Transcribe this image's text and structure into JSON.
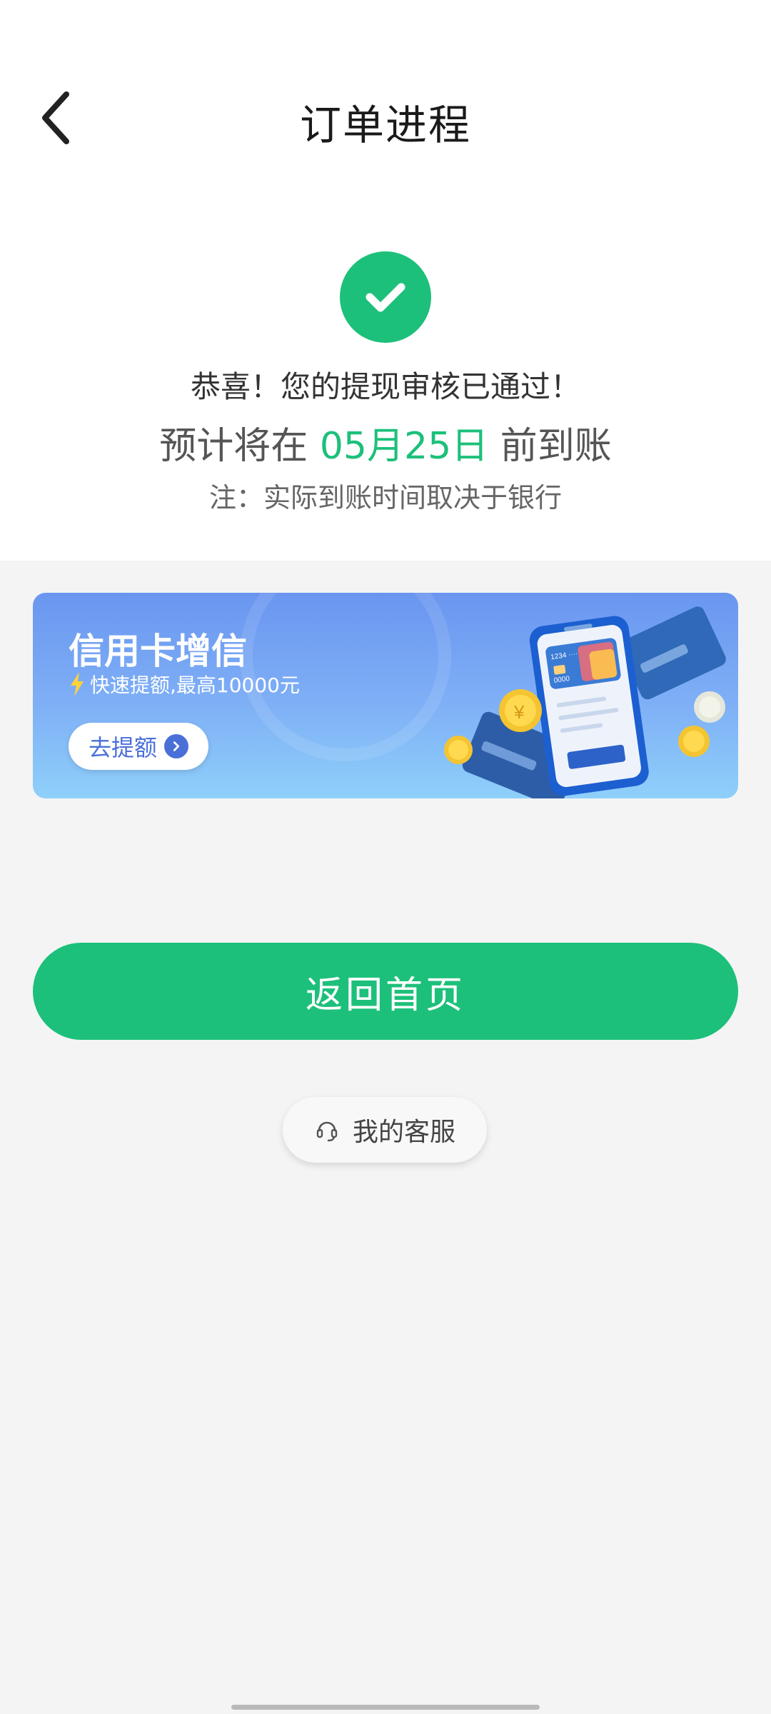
{
  "header": {
    "title": "订单进程"
  },
  "status": {
    "message": "恭喜！您的提现审核已通过！",
    "eta_prefix": "预计将在",
    "eta_date": "05月25日",
    "eta_suffix": "前到账",
    "note": "注：实际到账时间取决于银行"
  },
  "banner": {
    "title": "信用卡增信",
    "subtitle": "快速提额,最高10000元",
    "button_label": "去提额",
    "card_number": "1234 ····",
    "card_number2": "0000"
  },
  "actions": {
    "primary_label": "返回首页",
    "service_label": "我的客服"
  },
  "colors": {
    "accent": "#1cc07a",
    "banner_blue": "#6a96f0"
  },
  "icons": {
    "back": "chevron-left-icon",
    "success": "check-circle-icon",
    "lightning": "lightning-icon",
    "arrow": "arrow-right-icon",
    "headset": "headset-icon"
  }
}
